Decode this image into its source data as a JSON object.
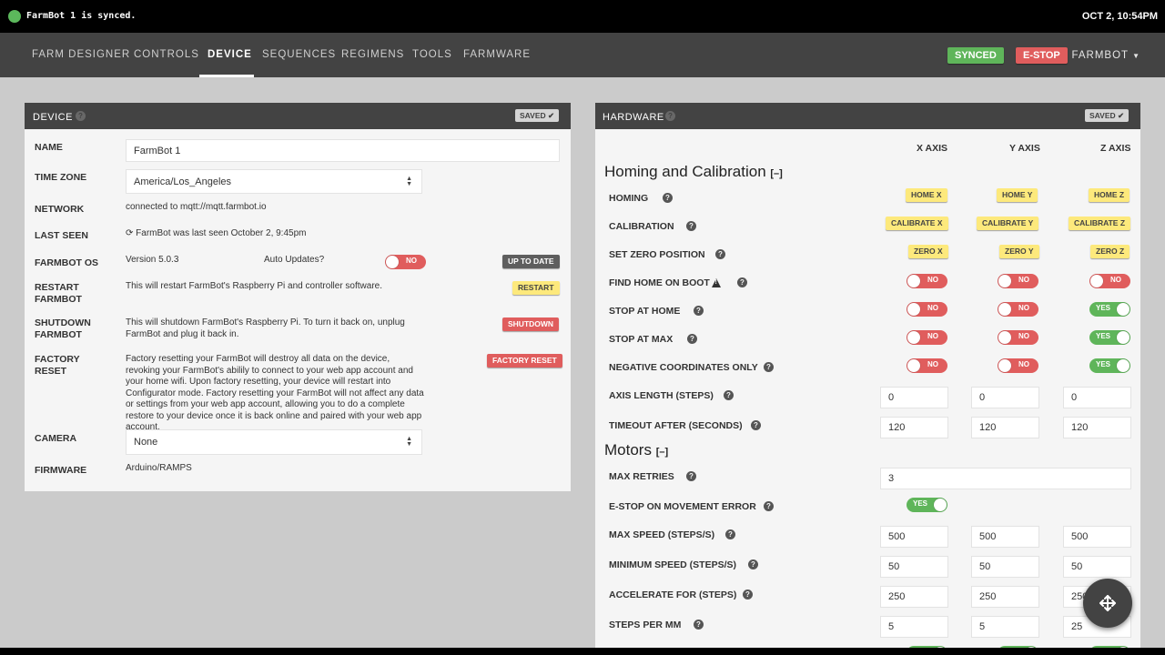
{
  "status_bar": {
    "message": "FarmBot 1 is synced.",
    "datetime": "OCT 2, 10:54PM",
    "dot_color": "#5cb85c"
  },
  "nav": {
    "links": [
      "FARM DESIGNER",
      "CONTROLS",
      "DEVICE",
      "SEQUENCES",
      "REGIMENS",
      "TOOLS",
      "FARMWARE"
    ],
    "active": "DEVICE",
    "synced_label": "SYNCED",
    "estop_label": "E-STOP",
    "user_label": "FARMBOT"
  },
  "device": {
    "title": "DEVICE",
    "saved_label": "SAVED",
    "name_label": "NAME",
    "name_value": "FarmBot 1",
    "timezone_label": "TIME ZONE",
    "timezone_value": "America/Los_Angeles",
    "network_label": "NETWORK",
    "network_value": "connected to mqtt://mqtt.farmbot.io",
    "last_seen_label": "LAST SEEN",
    "last_seen_value": "FarmBot was last seen October 2, 9:45pm",
    "os_label": "FARMBOT OS",
    "os_version": "Version 5.0.3",
    "auto_updates_label": "Auto Updates?",
    "auto_updates_state": "NO",
    "up_to_date_label": "UP TO DATE",
    "restart_label": "RESTART FARMBOT",
    "restart_desc": "This will restart FarmBot's Raspberry Pi and controller software.",
    "restart_button": "RESTART",
    "shutdown_label": "SHUTDOWN FARMBOT",
    "shutdown_desc": "This will shutdown FarmBot's Raspberry Pi. To turn it back on, unplug FarmBot and plug it back in.",
    "shutdown_button": "SHUTDOWN",
    "factory_label": "FACTORY RESET",
    "factory_desc": "Factory resetting your FarmBot will destroy all data on the device, revoking your FarmBot's abilily to connect to your web app account and your home wifi. Upon factory resetting, your device will restart into Configurator mode. Factory resetting your FarmBot will not affect any data or settings from your web app account, allowing you to do a complete restore to your device once it is back online and paired with your web app account.",
    "factory_button": "FACTORY RESET",
    "camera_label": "CAMERA",
    "camera_value": "None",
    "firmware_label": "FIRMWARE",
    "firmware_value": "Arduino/RAMPS"
  },
  "hardware": {
    "title": "HARDWARE",
    "saved_label": "SAVED",
    "axes": [
      "X AXIS",
      "Y AXIS",
      "Z AXIS"
    ],
    "homing_section": "Homing and Calibration",
    "collapse_glyph": "[–]",
    "motors_section": "Motors",
    "homing_label": "HOMING",
    "homing_buttons": [
      "HOME X",
      "HOME Y",
      "HOME Z"
    ],
    "calibration_label": "CALIBRATION",
    "calibration_buttons": [
      "CALIBRATE X",
      "CALIBRATE Y",
      "CALIBRATE Z"
    ],
    "zero_label": "SET ZERO POSITION",
    "zero_buttons": [
      "ZERO X",
      "ZERO Y",
      "ZERO Z"
    ],
    "find_home_label": "FIND HOME ON BOOT",
    "find_home": [
      "NO",
      "NO",
      "NO"
    ],
    "stop_home_label": "STOP AT HOME",
    "stop_home": [
      "NO",
      "NO",
      "YES"
    ],
    "stop_max_label": "STOP AT MAX",
    "stop_max": [
      "NO",
      "NO",
      "YES"
    ],
    "neg_label": "NEGATIVE COORDINATES ONLY",
    "neg": [
      "NO",
      "NO",
      "YES"
    ],
    "axis_length_label": "AXIS LENGTH (STEPS)",
    "axis_length": [
      "0",
      "0",
      "0"
    ],
    "timeout_label": "TIMEOUT AFTER (SECONDS)",
    "timeout": [
      "120",
      "120",
      "120"
    ],
    "max_retries_label": "MAX RETRIES",
    "max_retries": "3",
    "estop_move_label": "E-STOP ON MOVEMENT ERROR",
    "estop_move": "YES",
    "max_speed_label": "MAX SPEED (STEPS/S)",
    "max_speed": [
      "500",
      "500",
      "500"
    ],
    "min_speed_label": "MINIMUM SPEED (STEPS/S)",
    "min_speed": [
      "50",
      "50",
      "50"
    ],
    "accel_label": "ACCELERATE FOR (STEPS)",
    "accel": [
      "250",
      "250",
      "250"
    ],
    "steps_mm_label": "STEPS PER MM",
    "steps_mm": [
      "5",
      "5",
      "25"
    ]
  }
}
